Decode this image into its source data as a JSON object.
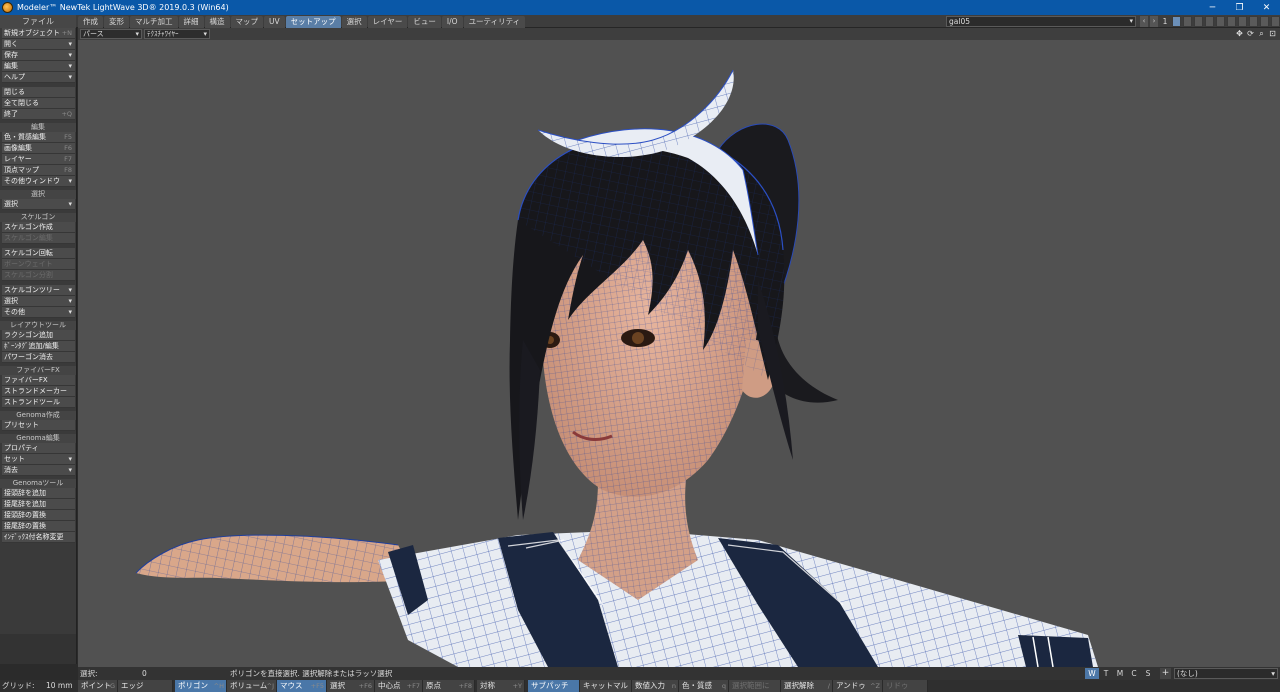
{
  "window": {
    "title": "Modeler™ NewTek LightWave 3D® 2019.0.3 (Win64)",
    "controls": [
      "─",
      "❐",
      "✕"
    ]
  },
  "menu_label": "ファイル",
  "tabs": [
    {
      "label": "作成",
      "active": false
    },
    {
      "label": "変形",
      "active": false
    },
    {
      "label": "マルチ加工",
      "active": false
    },
    {
      "label": "詳細",
      "active": false
    },
    {
      "label": "構造",
      "active": false
    },
    {
      "label": "マップ",
      "active": false
    },
    {
      "label": "UV",
      "active": false
    },
    {
      "label": "セットアップ",
      "active": true
    },
    {
      "label": "選択",
      "active": false
    },
    {
      "label": "レイヤー",
      "active": false
    },
    {
      "label": "ビュー",
      "active": false
    },
    {
      "label": "I/O",
      "active": false
    },
    {
      "label": "ユーティリティ",
      "active": false
    }
  ],
  "object_select": "gal05",
  "layer_number": "1",
  "toolbar": {
    "file_items": [
      {
        "label": "新規オブジェクト",
        "shortcut": "+N",
        "dropdown": false
      },
      {
        "label": "開く",
        "shortcut": "",
        "dropdown": true
      },
      {
        "label": "保存",
        "shortcut": "",
        "dropdown": true
      },
      {
        "label": "編集",
        "shortcut": "",
        "dropdown": true
      },
      {
        "label": "ヘルプ",
        "shortcut": "",
        "dropdown": true
      }
    ],
    "file_items2": [
      {
        "label": "閉じる",
        "shortcut": "",
        "dropdown": false
      },
      {
        "label": "全て閉じる",
        "shortcut": "",
        "dropdown": false
      },
      {
        "label": "終了",
        "shortcut": "+Q",
        "dropdown": false
      }
    ],
    "edit_header": "編集",
    "edit_items": [
      {
        "label": "色・質感編集",
        "shortcut": "F5"
      },
      {
        "label": "画像編集",
        "shortcut": "F6"
      },
      {
        "label": "レイヤー",
        "shortcut": "F7"
      },
      {
        "label": "頂点マップ",
        "shortcut": "F8"
      }
    ],
    "other_windows": "その他ウィンドウ",
    "select_header": "選択",
    "select_item": "選択",
    "skelegon_header": "スケルゴン",
    "skelegon_items": [
      {
        "label": "スケルゴン作成",
        "disabled": false
      },
      {
        "label": "スケルゴン編集",
        "disabled": true
      },
      {
        "label": "スケルゴン回転",
        "disabled": false
      },
      {
        "label": "ボーンウェイト",
        "disabled": true
      },
      {
        "label": "スケルゴン分割",
        "disabled": true
      }
    ],
    "skelegon_tree": "スケルゴンツリー",
    "skelegon_select": "選択",
    "skelegon_other": "その他",
    "layout_header": "レイアウトツール",
    "layout_items": [
      "ラクシゴン追加",
      "ﾎﾞｰﾝﾀｸﾞ追加/編集",
      "パワーゴン消去"
    ],
    "fiber_header": "ファイバーFX",
    "fiber_items": [
      "ファイバーFX",
      "ストランドメーカー",
      "ストランドツール"
    ],
    "genoma_create_header": "Genoma作成",
    "genoma_create_items": [
      "プリセット"
    ],
    "genoma_edit_header": "Genoma編集",
    "genoma_edit_items": [
      {
        "label": "プロパティ",
        "dropdown": false
      },
      {
        "label": "セット",
        "dropdown": true
      },
      {
        "label": "消去",
        "dropdown": true
      }
    ],
    "genoma_tool_header": "Genomaツール",
    "genoma_tool_items": [
      "接頭辞を追加",
      "接尾辞を追加",
      "接頭辞の置換",
      "接尾辞の置換",
      "ｲﾝﾃﾞｯｸｽ付名称変更"
    ]
  },
  "viewport": {
    "view_type": "パース",
    "render_mode": "ﾃｸｽﾁｬﾜｲﾔｰ",
    "icons": [
      "move-icon",
      "rotate-icon",
      "zoom-icon",
      "maximize-icon"
    ]
  },
  "status": {
    "selection_label": "選択:",
    "selection_count": "0",
    "message": "ポリゴンを直接選択. 選択解除またはラッソ選択",
    "view_modes": [
      "W",
      "T",
      "M",
      "C",
      "S"
    ],
    "active_view_mode": "W",
    "add_label": "+",
    "surface": "(なし)"
  },
  "bottom": {
    "grid_label": "グリッド:",
    "grid_value": "10 mm",
    "buttons": [
      {
        "label": "ポイント",
        "shortcut": "^G",
        "active": false,
        "disabled": false
      },
      {
        "label": "エッジ",
        "shortcut": "",
        "active": false,
        "disabled": false
      },
      {
        "label": "ポリゴン",
        "shortcut": "^H",
        "active": true,
        "disabled": false
      },
      {
        "label": "ボリューム",
        "shortcut": "^J",
        "active": false,
        "disabled": false
      },
      {
        "label": "マウス",
        "shortcut": "+F5",
        "active": true,
        "disabled": false
      },
      {
        "label": "選択",
        "shortcut": "+F6",
        "active": false,
        "disabled": false
      },
      {
        "label": "中心点",
        "shortcut": "+F7",
        "active": false,
        "disabled": false
      },
      {
        "label": "原点",
        "shortcut": "+F8",
        "active": false,
        "disabled": false
      },
      {
        "label": "対称",
        "shortcut": "+Y",
        "active": false,
        "disabled": false
      },
      {
        "label": "サブパッチ",
        "shortcut": "",
        "active": true,
        "disabled": false
      },
      {
        "label": "キャットマル",
        "shortcut": "",
        "active": false,
        "disabled": false
      },
      {
        "label": "数値入力",
        "shortcut": "n",
        "active": false,
        "disabled": false
      },
      {
        "label": "色・質感",
        "shortcut": "q",
        "active": false,
        "disabled": false
      },
      {
        "label": "選択範囲に",
        "shortcut": "",
        "active": false,
        "disabled": true
      },
      {
        "label": "選択解除",
        "shortcut": "/",
        "active": false,
        "disabled": false
      },
      {
        "label": "アンドゥ",
        "shortcut": "^Z",
        "active": false,
        "disabled": false
      },
      {
        "label": "リドゥ",
        "shortcut": "",
        "active": false,
        "disabled": true
      }
    ]
  }
}
